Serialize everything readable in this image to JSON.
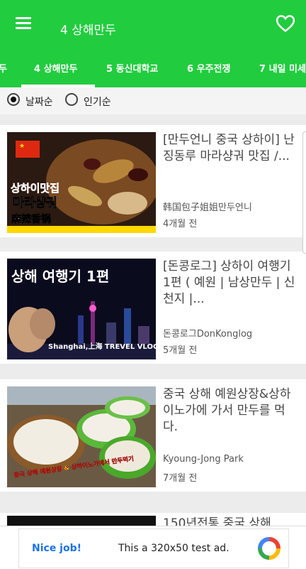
{
  "app": {
    "title": "4 상해만두"
  },
  "tabs": [
    {
      "label": "두"
    },
    {
      "label": "4 상해만두"
    },
    {
      "label": "5 동신대학교"
    },
    {
      "label": "6 우주전쟁"
    },
    {
      "label": "7 내일 미세"
    }
  ],
  "sort": {
    "option_date": "날짜순",
    "option_popular": "인기순",
    "selected": "날짜순"
  },
  "videos": [
    {
      "title": "[만두언니 중국 상하이] 난징동루 마라샹궈 맛집 /...",
      "channel": "韩国包子姐姐만두언니",
      "age": "4개월 전",
      "thumb_text1": "상하이맛집",
      "thumb_text2": "마라샹궈",
      "thumb_text3": "麻辣香锅"
    },
    {
      "title": "[돈콩로그] 상하이 여행기 1편 ( 예원 | 남상만두 | 신천지 |...",
      "channel": "돈콩로그DonKonglog",
      "age": "5개월 전",
      "thumb_text1": "상해 여행기 1편",
      "thumb_text2": "Shanghai,上海 TREVEL VLOG"
    },
    {
      "title": "중국 상해 예원상장&상하이노가에 가서 만두를 먹다.",
      "channel": "Kyoung-Jong Park",
      "age": "7개월 전",
      "thumb_text1": "중국 상해 예원상장 & 상하이노가에서 만두먹기"
    },
    {
      "title": "150년전통 중국 상해"
    }
  ],
  "ad": {
    "nice": "Nice job!",
    "text": "This a 320x50 test ad."
  },
  "colors": {
    "primary": "#22cc3f",
    "ad_link": "#1a73e8"
  }
}
